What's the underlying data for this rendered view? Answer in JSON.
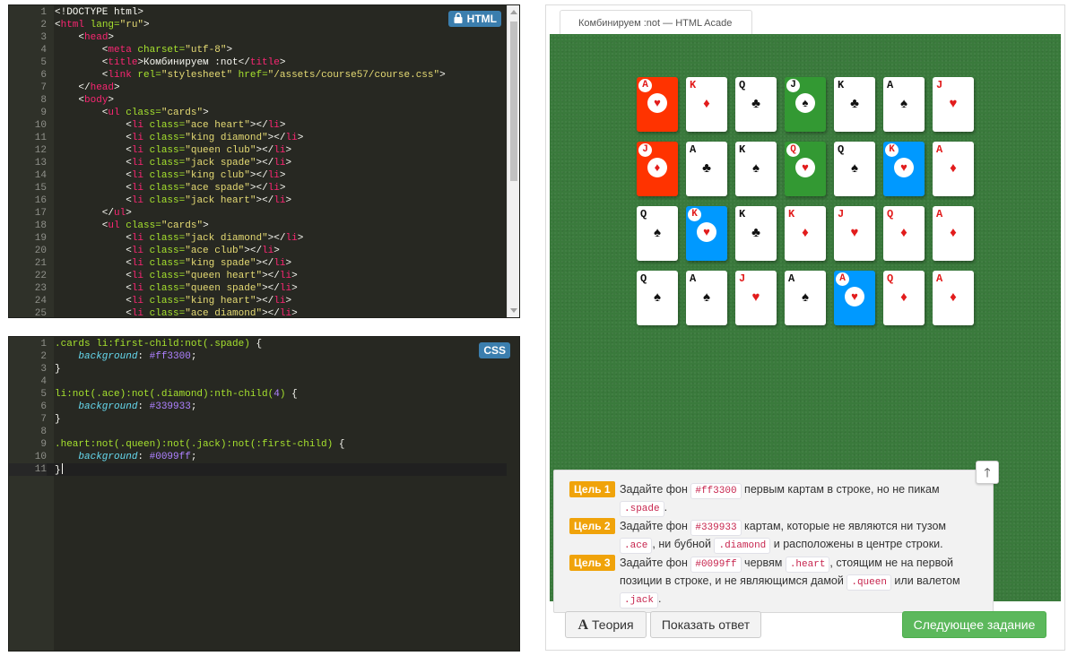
{
  "html_editor": {
    "badge": "HTML",
    "lines": [
      {
        "n": "1",
        "tokens": [
          [
            "t-txt",
            "<!DOCTYPE html>"
          ]
        ]
      },
      {
        "n": "2",
        "tokens": [
          [
            "t-txt",
            "<"
          ],
          [
            "t-tag",
            "html"
          ],
          [
            "t-attr",
            " lang="
          ],
          [
            "t-str",
            "\"ru\""
          ],
          [
            "t-txt",
            ">"
          ]
        ]
      },
      {
        "n": "3",
        "tokens": [
          [
            "t-txt",
            "    <"
          ],
          [
            "t-tag",
            "head"
          ],
          [
            "t-txt",
            ">"
          ]
        ]
      },
      {
        "n": "4",
        "tokens": [
          [
            "t-txt",
            "        <"
          ],
          [
            "t-tag",
            "meta"
          ],
          [
            "t-attr",
            " charset="
          ],
          [
            "t-str",
            "\"utf-8\""
          ],
          [
            "t-txt",
            ">"
          ]
        ]
      },
      {
        "n": "5",
        "tokens": [
          [
            "t-txt",
            "        <"
          ],
          [
            "t-tag",
            "title"
          ],
          [
            "t-txt",
            ">Комбинируем :not</"
          ],
          [
            "t-tag",
            "title"
          ],
          [
            "t-txt",
            ">"
          ]
        ]
      },
      {
        "n": "6",
        "tokens": [
          [
            "t-txt",
            "        <"
          ],
          [
            "t-tag",
            "link"
          ],
          [
            "t-attr",
            " rel="
          ],
          [
            "t-str",
            "\"stylesheet\""
          ],
          [
            "t-attr",
            " href="
          ],
          [
            "t-str",
            "\"/assets/course57/course.css\""
          ],
          [
            "t-txt",
            ">"
          ]
        ]
      },
      {
        "n": "7",
        "tokens": [
          [
            "t-txt",
            "    </"
          ],
          [
            "t-tag",
            "head"
          ],
          [
            "t-txt",
            ">"
          ]
        ]
      },
      {
        "n": "8",
        "tokens": [
          [
            "t-txt",
            "    <"
          ],
          [
            "t-tag",
            "body"
          ],
          [
            "t-txt",
            ">"
          ]
        ]
      },
      {
        "n": "9",
        "tokens": [
          [
            "t-txt",
            "        <"
          ],
          [
            "t-tag",
            "ul"
          ],
          [
            "t-attr",
            " class="
          ],
          [
            "t-str",
            "\"cards\""
          ],
          [
            "t-txt",
            ">"
          ]
        ]
      },
      {
        "n": "10",
        "tokens": [
          [
            "t-txt",
            "            <"
          ],
          [
            "t-tag",
            "li"
          ],
          [
            "t-attr",
            " class="
          ],
          [
            "t-str",
            "\"ace heart\""
          ],
          [
            "t-txt",
            "></"
          ],
          [
            "t-tag",
            "li"
          ],
          [
            "t-txt",
            ">"
          ]
        ]
      },
      {
        "n": "11",
        "tokens": [
          [
            "t-txt",
            "            <"
          ],
          [
            "t-tag",
            "li"
          ],
          [
            "t-attr",
            " class="
          ],
          [
            "t-str",
            "\"king diamond\""
          ],
          [
            "t-txt",
            "></"
          ],
          [
            "t-tag",
            "li"
          ],
          [
            "t-txt",
            ">"
          ]
        ]
      },
      {
        "n": "12",
        "tokens": [
          [
            "t-txt",
            "            <"
          ],
          [
            "t-tag",
            "li"
          ],
          [
            "t-attr",
            " class="
          ],
          [
            "t-str",
            "\"queen club\""
          ],
          [
            "t-txt",
            "></"
          ],
          [
            "t-tag",
            "li"
          ],
          [
            "t-txt",
            ">"
          ]
        ]
      },
      {
        "n": "13",
        "tokens": [
          [
            "t-txt",
            "            <"
          ],
          [
            "t-tag",
            "li"
          ],
          [
            "t-attr",
            " class="
          ],
          [
            "t-str",
            "\"jack spade\""
          ],
          [
            "t-txt",
            "></"
          ],
          [
            "t-tag",
            "li"
          ],
          [
            "t-txt",
            ">"
          ]
        ]
      },
      {
        "n": "14",
        "tokens": [
          [
            "t-txt",
            "            <"
          ],
          [
            "t-tag",
            "li"
          ],
          [
            "t-attr",
            " class="
          ],
          [
            "t-str",
            "\"king club\""
          ],
          [
            "t-txt",
            "></"
          ],
          [
            "t-tag",
            "li"
          ],
          [
            "t-txt",
            ">"
          ]
        ]
      },
      {
        "n": "15",
        "tokens": [
          [
            "t-txt",
            "            <"
          ],
          [
            "t-tag",
            "li"
          ],
          [
            "t-attr",
            " class="
          ],
          [
            "t-str",
            "\"ace spade\""
          ],
          [
            "t-txt",
            "></"
          ],
          [
            "t-tag",
            "li"
          ],
          [
            "t-txt",
            ">"
          ]
        ]
      },
      {
        "n": "16",
        "tokens": [
          [
            "t-txt",
            "            <"
          ],
          [
            "t-tag",
            "li"
          ],
          [
            "t-attr",
            " class="
          ],
          [
            "t-str",
            "\"jack heart\""
          ],
          [
            "t-txt",
            "></"
          ],
          [
            "t-tag",
            "li"
          ],
          [
            "t-txt",
            ">"
          ]
        ]
      },
      {
        "n": "17",
        "tokens": [
          [
            "t-txt",
            "        </"
          ],
          [
            "t-tag",
            "ul"
          ],
          [
            "t-txt",
            ">"
          ]
        ]
      },
      {
        "n": "18",
        "tokens": [
          [
            "t-txt",
            "        <"
          ],
          [
            "t-tag",
            "ul"
          ],
          [
            "t-attr",
            " class="
          ],
          [
            "t-str",
            "\"cards\""
          ],
          [
            "t-txt",
            ">"
          ]
        ]
      },
      {
        "n": "19",
        "tokens": [
          [
            "t-txt",
            "            <"
          ],
          [
            "t-tag",
            "li"
          ],
          [
            "t-attr",
            " class="
          ],
          [
            "t-str",
            "\"jack diamond\""
          ],
          [
            "t-txt",
            "></"
          ],
          [
            "t-tag",
            "li"
          ],
          [
            "t-txt",
            ">"
          ]
        ]
      },
      {
        "n": "20",
        "tokens": [
          [
            "t-txt",
            "            <"
          ],
          [
            "t-tag",
            "li"
          ],
          [
            "t-attr",
            " class="
          ],
          [
            "t-str",
            "\"ace club\""
          ],
          [
            "t-txt",
            "></"
          ],
          [
            "t-tag",
            "li"
          ],
          [
            "t-txt",
            ">"
          ]
        ]
      },
      {
        "n": "21",
        "tokens": [
          [
            "t-txt",
            "            <"
          ],
          [
            "t-tag",
            "li"
          ],
          [
            "t-attr",
            " class="
          ],
          [
            "t-str",
            "\"king spade\""
          ],
          [
            "t-txt",
            "></"
          ],
          [
            "t-tag",
            "li"
          ],
          [
            "t-txt",
            ">"
          ]
        ]
      },
      {
        "n": "22",
        "tokens": [
          [
            "t-txt",
            "            <"
          ],
          [
            "t-tag",
            "li"
          ],
          [
            "t-attr",
            " class="
          ],
          [
            "t-str",
            "\"queen heart\""
          ],
          [
            "t-txt",
            "></"
          ],
          [
            "t-tag",
            "li"
          ],
          [
            "t-txt",
            ">"
          ]
        ]
      },
      {
        "n": "23",
        "tokens": [
          [
            "t-txt",
            "            <"
          ],
          [
            "t-tag",
            "li"
          ],
          [
            "t-attr",
            " class="
          ],
          [
            "t-str",
            "\"queen spade\""
          ],
          [
            "t-txt",
            "></"
          ],
          [
            "t-tag",
            "li"
          ],
          [
            "t-txt",
            ">"
          ]
        ]
      },
      {
        "n": "24",
        "tokens": [
          [
            "t-txt",
            "            <"
          ],
          [
            "t-tag",
            "li"
          ],
          [
            "t-attr",
            " class="
          ],
          [
            "t-str",
            "\"king heart\""
          ],
          [
            "t-txt",
            "></"
          ],
          [
            "t-tag",
            "li"
          ],
          [
            "t-txt",
            ">"
          ]
        ]
      },
      {
        "n": "25",
        "tokens": [
          [
            "t-txt",
            "            <"
          ],
          [
            "t-tag",
            "li"
          ],
          [
            "t-attr",
            " class="
          ],
          [
            "t-str",
            "\"ace diamond\""
          ],
          [
            "t-txt",
            "></"
          ],
          [
            "t-tag",
            "li"
          ],
          [
            "t-txt",
            ">"
          ]
        ]
      }
    ]
  },
  "css_editor": {
    "badge": "CSS",
    "lines": [
      {
        "n": "1",
        "tokens": [
          [
            "t-sel",
            ".cards li:first-child:not(.spade)"
          ],
          [
            "t-txt",
            " {"
          ]
        ]
      },
      {
        "n": "2",
        "tokens": [
          [
            "t-txt",
            "    "
          ],
          [
            "t-prop",
            "background"
          ],
          [
            "t-txt",
            ": "
          ],
          [
            "t-val",
            "#ff3300"
          ],
          [
            "t-txt",
            ";"
          ]
        ]
      },
      {
        "n": "3",
        "tokens": [
          [
            "t-txt",
            "}"
          ]
        ]
      },
      {
        "n": "4",
        "tokens": []
      },
      {
        "n": "5",
        "tokens": [
          [
            "t-sel",
            "li:not(.ace):not(.diamond):nth-child("
          ],
          [
            "t-num",
            "4"
          ],
          [
            "t-sel",
            ")"
          ],
          [
            "t-txt",
            " {"
          ]
        ]
      },
      {
        "n": "6",
        "tokens": [
          [
            "t-txt",
            "    "
          ],
          [
            "t-prop",
            "background"
          ],
          [
            "t-txt",
            ": "
          ],
          [
            "t-val",
            "#339933"
          ],
          [
            "t-txt",
            ";"
          ]
        ]
      },
      {
        "n": "7",
        "tokens": [
          [
            "t-txt",
            "}"
          ]
        ]
      },
      {
        "n": "8",
        "tokens": []
      },
      {
        "n": "9",
        "tokens": [
          [
            "t-sel",
            ".heart:not(.queen):not(.jack):not(:first-child)"
          ],
          [
            "t-txt",
            " {"
          ]
        ]
      },
      {
        "n": "10",
        "tokens": [
          [
            "t-txt",
            "    "
          ],
          [
            "t-prop",
            "background"
          ],
          [
            "t-txt",
            ": "
          ],
          [
            "t-val",
            "#0099ff"
          ],
          [
            "t-txt",
            ";"
          ]
        ]
      },
      {
        "n": "11",
        "tokens": [
          [
            "t-txt",
            "}"
          ]
        ],
        "cursor": true
      }
    ]
  },
  "preview": {
    "tab_title": "Комбинируем :not — HTML Acade",
    "suits": {
      "heart": "♥",
      "diamond": "♦",
      "club": "♣",
      "spade": "♠"
    },
    "colors": {
      "red": "#ff3300",
      "green": "#339933",
      "blue": "#0099ff"
    },
    "rows": [
      [
        {
          "rank": "A",
          "suit": "heart",
          "bg": "red"
        },
        {
          "rank": "K",
          "suit": "diamond"
        },
        {
          "rank": "Q",
          "suit": "club"
        },
        {
          "rank": "J",
          "suit": "spade",
          "bg": "green"
        },
        {
          "rank": "K",
          "suit": "club"
        },
        {
          "rank": "A",
          "suit": "spade"
        },
        {
          "rank": "J",
          "suit": "heart"
        }
      ],
      [
        {
          "rank": "J",
          "suit": "diamond",
          "bg": "red"
        },
        {
          "rank": "A",
          "suit": "club"
        },
        {
          "rank": "K",
          "suit": "spade"
        },
        {
          "rank": "Q",
          "suit": "heart",
          "bg": "green"
        },
        {
          "rank": "Q",
          "suit": "spade"
        },
        {
          "rank": "K",
          "suit": "heart",
          "bg": "blue"
        },
        {
          "rank": "A",
          "suit": "diamond"
        }
      ],
      [
        {
          "rank": "Q",
          "suit": "spade"
        },
        {
          "rank": "K",
          "suit": "heart",
          "bg": "blue"
        },
        {
          "rank": "K",
          "suit": "club"
        },
        {
          "rank": "K",
          "suit": "diamond"
        },
        {
          "rank": "J",
          "suit": "heart"
        },
        {
          "rank": "Q",
          "suit": "diamond"
        },
        {
          "rank": "A",
          "suit": "diamond"
        }
      ],
      [
        {
          "rank": "Q",
          "suit": "spade"
        },
        {
          "rank": "A",
          "suit": "spade"
        },
        {
          "rank": "J",
          "suit": "heart"
        },
        {
          "rank": "A",
          "suit": "spade"
        },
        {
          "rank": "A",
          "suit": "heart",
          "bg": "blue"
        },
        {
          "rank": "Q",
          "suit": "diamond"
        },
        {
          "rank": "A",
          "suit": "diamond"
        }
      ]
    ]
  },
  "goals": [
    {
      "label": "Цель 1",
      "parts": [
        [
          "t",
          "Задайте фон "
        ],
        [
          "c",
          "#ff3300"
        ],
        [
          "t",
          " первым картам в строке, но не пикам "
        ],
        [
          "c",
          ".spade"
        ],
        [
          "t",
          "."
        ]
      ]
    },
    {
      "label": "Цель 2",
      "parts": [
        [
          "t",
          "Задайте фон "
        ],
        [
          "c",
          "#339933"
        ],
        [
          "t",
          " картам, которые не являются ни тузом "
        ],
        [
          "c",
          ".ace"
        ],
        [
          "t",
          ", ни бубной "
        ],
        [
          "c",
          ".diamond"
        ],
        [
          "t",
          " и расположены в центре строки."
        ]
      ]
    },
    {
      "label": "Цель 3",
      "parts": [
        [
          "t",
          "Задайте фон "
        ],
        [
          "c",
          "#0099ff"
        ],
        [
          "t",
          " червям "
        ],
        [
          "c",
          ".heart"
        ],
        [
          "t",
          ", стоящим не на первой позиции в строке, и не являющимся дамой "
        ],
        [
          "c",
          ".queen"
        ],
        [
          "t",
          " или валетом "
        ],
        [
          "c",
          ".jack"
        ],
        [
          "t",
          "."
        ]
      ]
    }
  ],
  "buttons": {
    "theory_icon": "A",
    "theory": "Теория",
    "show_answer": "Показать ответ",
    "next": "Следующее задание",
    "up_arrow": "🡑"
  }
}
